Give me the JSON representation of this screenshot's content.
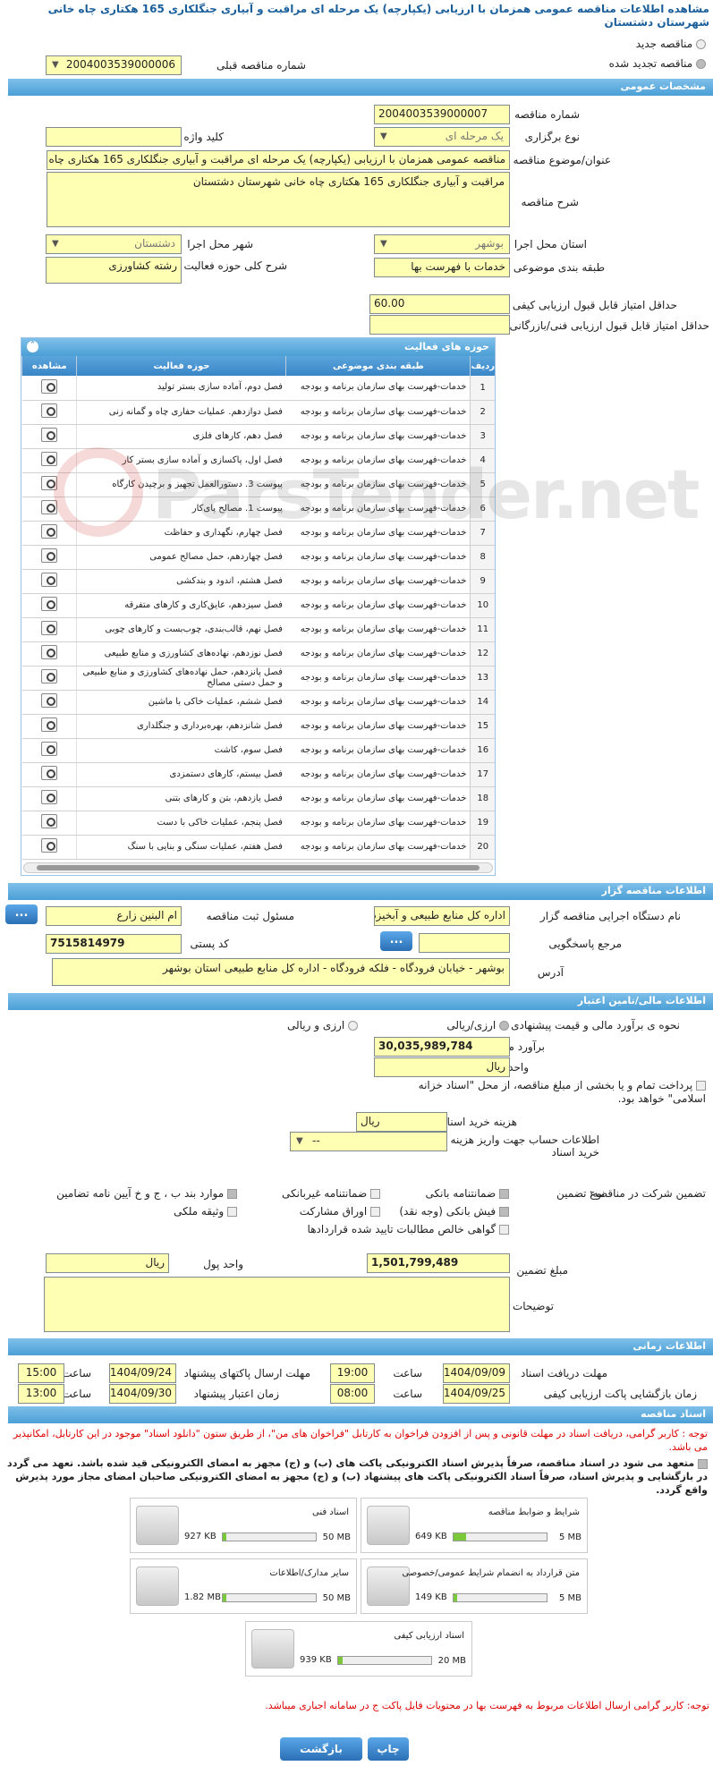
{
  "header": {
    "title": "مشاهده اطلاعات مناقصه عمومی همزمان با ارزیابی (یکپارچه) یک مرحله ای مراقبت و آبیاری جنگلکاری 165 هکتاری چاه خانی شهرستان دشتستان"
  },
  "type": {
    "new_label": "مناقصه جدید",
    "renewed_label": "مناقصه تجدید شده",
    "prev_label": "شماره مناقصه قبلی",
    "prev_value": "2004003539000006"
  },
  "general": {
    "section_title": "مشخصات عمومی",
    "number_label": "شماره مناقصه",
    "number_value": "2004003539000007",
    "kind_label": "نوع برگزاری",
    "kind_value": "یک مرحله ای",
    "keyword_label": "کلید واژه",
    "keyword_value": "",
    "subject_label": "عنوان/موضوع مناقصه",
    "subject_value": "مناقصه عمومی همزمان با ارزیابی (یکپارچه) یک مرحله ای مراقبت و آبیاری جنگلکاری 165 هکتاری چاه خانی شهرستان دشتستان",
    "desc_label": "شرح مناقصه",
    "desc_value": "مراقبت و آبیاری جنگلکاری 165 هکتاری چاه خانی شهرستان دشتستان",
    "province_label": "استان محل اجرا",
    "province_value": "بوشهر",
    "city_label": "شهر محل اجرا",
    "city_value": "دشتستان",
    "category_label": "طبقه بندی موضوعی",
    "category_value": "خدمات با فهرست بها",
    "activity_label": "شرح کلی حوزه فعالیت",
    "activity_value": "رشته کشاورزی",
    "quality_label": "حداقل امتیاز قابل قبول ارزیابی کیفی",
    "quality_value": "60.00",
    "tech_label": "حداقل امتیاز قابل قبول ارزیابی فنی/بازرگانی",
    "tech_value": ""
  },
  "activities": {
    "panel_title": "حوزه های فعالیت",
    "headers": [
      "ردیف",
      "طبقه بندی موضوعی",
      "حوزه فعالیت",
      "مشاهده"
    ],
    "rows": [
      {
        "i": "1",
        "cat": "خدمات-فهرست بهای سازمان برنامه و بودجه",
        "act": "فصل دوم، آماده سازی بستر تولید"
      },
      {
        "i": "2",
        "cat": "خدمات-فهرست بهای سازمان برنامه و بودجه",
        "act": "فصل دوازدهم. عملیات حفاری چاه و گمانه زنی"
      },
      {
        "i": "3",
        "cat": "خدمات-فهرست بهای سازمان برنامه و بودجه",
        "act": "فصل دهم، کارهای فلزی"
      },
      {
        "i": "4",
        "cat": "خدمات-فهرست بهای سازمان برنامه و بودجه",
        "act": "فصل اول، پاکسازی و آماده سازی بستر کار"
      },
      {
        "i": "5",
        "cat": "خدمات-فهرست بهای سازمان برنامه و بودجه",
        "act": "پیوست 3. دستورالعمل تجهیز و برچیدن کارگاه"
      },
      {
        "i": "6",
        "cat": "خدمات-فهرست بهای سازمان برنامه و بودجه",
        "act": "پیوست 1. مصالح پای‌کار"
      },
      {
        "i": "7",
        "cat": "خدمات-فهرست بهای سازمان برنامه و بودجه",
        "act": "فصل چهارم، نگهداری و حفاظت"
      },
      {
        "i": "8",
        "cat": "خدمات-فهرست بهای سازمان برنامه و بودجه",
        "act": "فصل چهاردهم، حمل مصالح عمومی"
      },
      {
        "i": "9",
        "cat": "خدمات-فهرست بهای سازمان برنامه و بودجه",
        "act": "فصل هشتم، اندود و بندکشی"
      },
      {
        "i": "10",
        "cat": "خدمات-فهرست بهای سازمان برنامه و بودجه",
        "act": "فصل سیزدهم، عایق‌کاری و کارهای متفرقه"
      },
      {
        "i": "11",
        "cat": "خدمات-فهرست بهای سازمان برنامه و بودجه",
        "act": "فصل نهم، قالب‌بندی، چوب‌بست و کارهای چوبی"
      },
      {
        "i": "12",
        "cat": "خدمات-فهرست بهای سازمان برنامه و بودجه",
        "act": "فصل نوزدهم، نهاده‌های کشاورزی و منابع طبیعی"
      },
      {
        "i": "13",
        "cat": "خدمات-فهرست بهای سازمان برنامه و بودجه",
        "act": "فصل پانزدهم، حمل نهاده‌های کشاورزی و منابع طبیعی و حمل دستی مصالح"
      },
      {
        "i": "14",
        "cat": "خدمات-فهرست بهای سازمان برنامه و بودجه",
        "act": "فصل ششم، عملیات خاکی با ماشین"
      },
      {
        "i": "15",
        "cat": "خدمات-فهرست بهای سازمان برنامه و بودجه",
        "act": "فصل شانزدهم، بهره‌برداری و جنگلداری"
      },
      {
        "i": "16",
        "cat": "خدمات-فهرست بهای سازمان برنامه و بودجه",
        "act": "فصل سوم، کاشت"
      },
      {
        "i": "17",
        "cat": "خدمات-فهرست بهای سازمان برنامه و بودجه",
        "act": "فصل بیستم، کارهای دستمزدی"
      },
      {
        "i": "18",
        "cat": "خدمات-فهرست بهای سازمان برنامه و بودجه",
        "act": "فصل یازدهم، بتن و کارهای بتنی"
      },
      {
        "i": "19",
        "cat": "خدمات-فهرست بهای سازمان برنامه و بودجه",
        "act": "فصل پنجم، عملیات خاکی با دست"
      },
      {
        "i": "20",
        "cat": "خدمات-فهرست بهای سازمان برنامه و بودجه",
        "act": "فصل هفتم، عملیات سنگی و بنایی با سنگ"
      }
    ]
  },
  "organizer": {
    "section_title": "اطلاعات مناقصه گزار",
    "org_label": "نام دستگاه اجرایی مناقصه گزار",
    "org_value": "اداره کل منابع طبیعی و آبخیزداری استان بوشهر",
    "resp_label": "مسئول ثبت مناقصه",
    "resp_value": "ام البنین زارع",
    "ref_label": "مرجع پاسخگویی",
    "ref_value": "",
    "postal_label": "کد پستی",
    "postal_value": "7515814979",
    "addr_label": "آدرس",
    "addr_value": "بوشهر - خیابان فرودگاه - فلکه فرودگاه - اداره کل منابع طبیعی استان بوشهر",
    "btn_dots": "..."
  },
  "finance": {
    "section_title": "اطلاعات مالی/تامین اعتبار",
    "estimate_label": "نحوه ی برآورد مالی و قیمت پیشنهادی",
    "opt_rial": "ارزی/ریالی",
    "opt_both": "ارزی و ریالی",
    "amount_label": "برآورد مالی",
    "amount_value": "30,035,989,784",
    "currency_label": "واحد پول",
    "currency_value": "ریال",
    "pay_note": "پرداخت تمام و یا بخشی از مبلغ مناقصه، از محل \"اسناد خزانه اسلامی\" خواهد بود.",
    "doc_cost_label": "هزینه خرید اسناد",
    "doc_cost_unit": "ریال",
    "account_label": "اطلاعات حساب جهت واریز هزینه خرید اسناد",
    "account_value": "--",
    "guarantee_label": "تضمین شرکت در مناقصه:",
    "gtype_label": "نوع تضمین",
    "g1": "ضمانتنامه بانکی",
    "g2": "ضمانتنامه غیربانکی",
    "g3": "موارد بند ب ، ج و خ آیین نامه تضامین",
    "g4": "فیش بانکی (وجه نقد)",
    "g5": "اوراق مشارکت",
    "g6": "وثیقه ملکی",
    "g7": "گواهی خالص مطالبات تایید شده قراردادها",
    "gamount_label": "مبلغ تضمین",
    "gamount_value": "1,501,799,489",
    "gunit_label": "واحد پول",
    "gunit_value": "ریال",
    "notes_label": "توضیحات"
  },
  "timing": {
    "section_title": "اطلاعات زمانی",
    "recv_label": "مهلت دریافت اسناد",
    "recv_date": "1404/09/09",
    "recv_time": "19:00",
    "send_label": "مهلت ارسال پاکتهای پیشنهاد",
    "send_date": "1404/09/24",
    "send_time": "15:00",
    "open_label": "زمان بازگشایی پاکت ارزیابی کیفی",
    "open_date": "1404/09/25",
    "open_time": "08:00",
    "valid_label": "زمان اعتبار پیشنهاد",
    "valid_date": "1404/09/30",
    "valid_time": "13:00",
    "time_label": "ساعت"
  },
  "docs": {
    "section_title": "اسناد مناقصه",
    "note1": "توجه : کاربر گرامی، دریافت اسناد در مهلت قانونی و پس از افزودن فراخوان به کارتابل \"فراخوان های من\"، از طریق ستون \"دانلود اسناد\" موجود در این کارتابل، امکانپذیر می باشد.",
    "commit": "متعهد می شود در اسناد مناقصه، صرفاً پذیرش اسناد الکترونیکی پاکت های (ب) و (ج) مجهز به امضای الکترونیکی قید شده باشد. تعهد می گردد در بازگشایی و پذیرش اسناد، صرفاً اسناد الکترونیکی پاکت های پیشنهاد (ب) و (ج) مجهز به امضای الکترونیکی صاحبان امضای مجاز مورد پذیرش واقع گردد.",
    "items": [
      {
        "title": "شرایط و ضوابط مناقصه",
        "size": "649 KB",
        "max": "5 MB",
        "fill": 0.13
      },
      {
        "title": "اسناد فنی",
        "size": "927 KB",
        "max": "50 MB",
        "fill": 0.02
      },
      {
        "title": "متن قرارداد به انضمام شرایط عمومی/خصوصی",
        "size": "149 KB",
        "max": "5 MB",
        "fill": 0.03
      },
      {
        "title": "سایر مدارک/اطلاعات",
        "size": "1.82 MB",
        "max": "50 MB",
        "fill": 0.04
      },
      {
        "title": "اسناد ارزیابی کیفی",
        "size": "939 KB",
        "max": "20 MB",
        "fill": 0.05
      }
    ],
    "note2": "توجه: کاربر گرامی ارسال اطلاعات مربوط به فهرست بها در محتویات فایل پاکت ج در سامانه اجباری میباشد."
  },
  "buttons": {
    "back": "بازگشت",
    "print": "چاپ"
  },
  "watermark": "ParsTender.net"
}
